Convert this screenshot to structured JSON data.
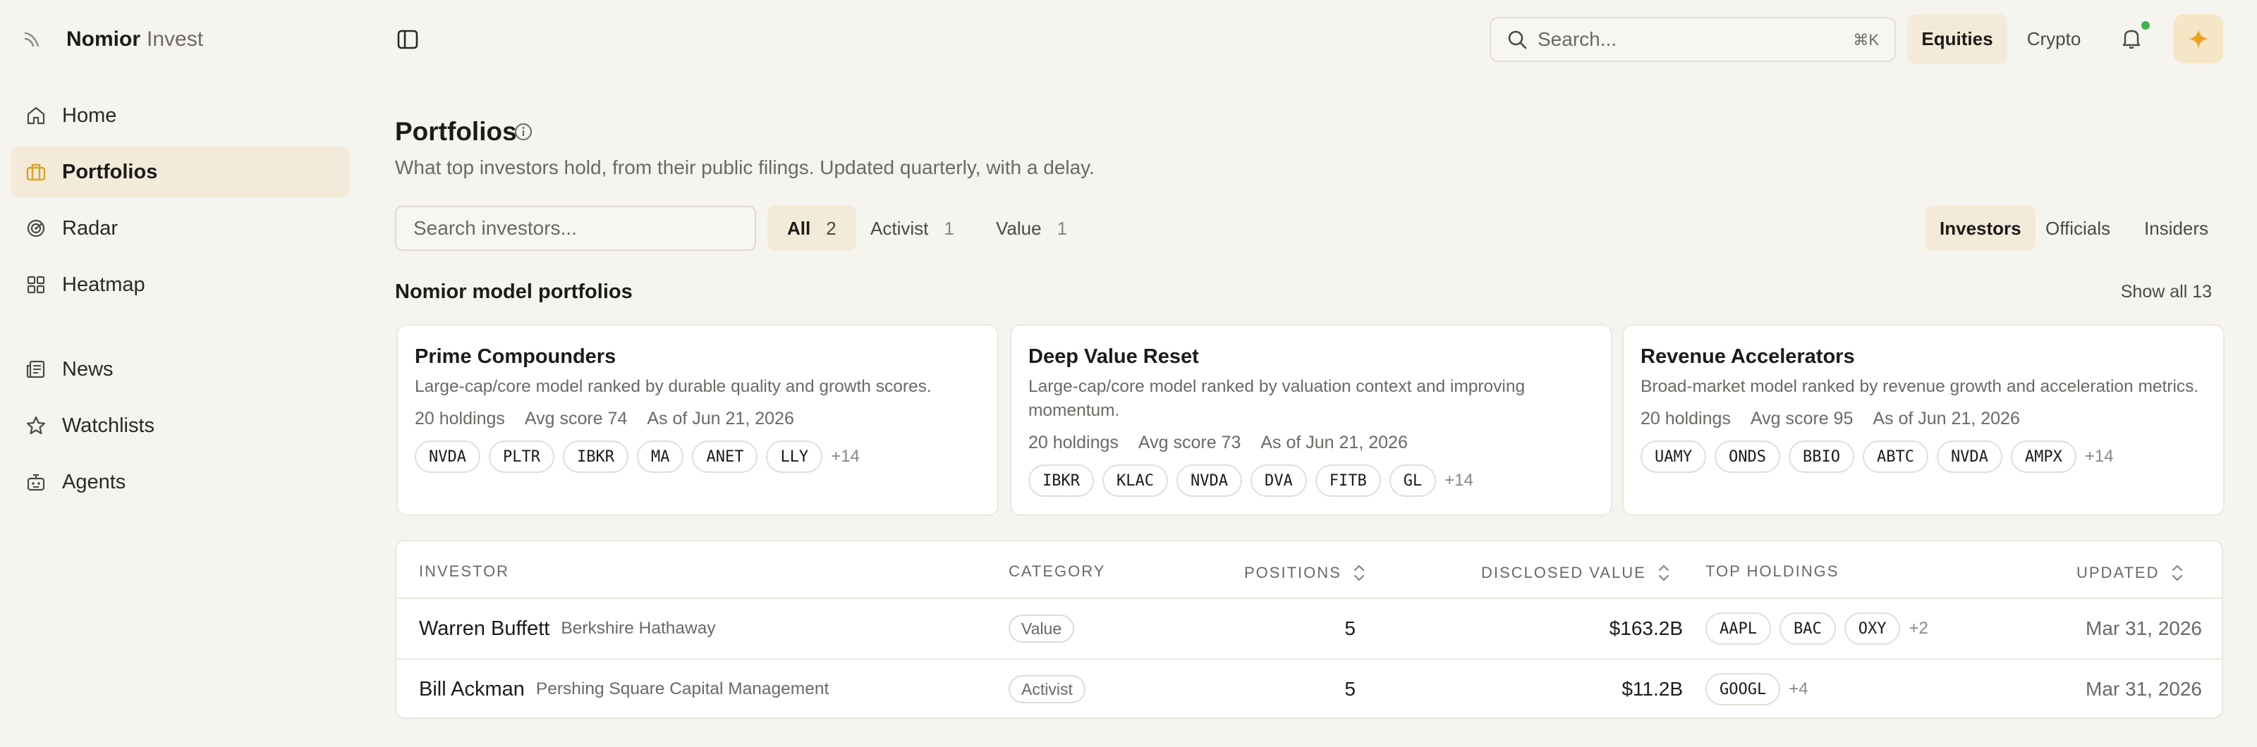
{
  "brand": {
    "name": "Nomior",
    "sub": "Invest"
  },
  "sidebar": {
    "items": [
      {
        "label": "Home",
        "icon": "home-icon"
      },
      {
        "label": "Portfolios",
        "icon": "briefcase-icon",
        "active": true
      },
      {
        "label": "Radar",
        "icon": "radar-icon"
      },
      {
        "label": "Heatmap",
        "icon": "grid-icon"
      },
      {
        "label": "News",
        "icon": "newspaper-icon"
      },
      {
        "label": "Watchlists",
        "icon": "star-icon"
      },
      {
        "label": "Agents",
        "icon": "bot-icon"
      }
    ]
  },
  "topbar": {
    "search_placeholder": "Search...",
    "search_shortcut": "⌘K",
    "segments": [
      "Equities",
      "Crypto"
    ],
    "accent_color": "#f0a020",
    "notification_dot_color": "#3bb54a"
  },
  "page": {
    "title": "Portfolios",
    "subtitle": "What top investors hold, from their public filings. Updated quarterly, with a delay."
  },
  "filters": {
    "search_placeholder": "Search investors...",
    "chips": [
      {
        "label": "All",
        "count": "2"
      },
      {
        "label": "Activist",
        "count": "1"
      },
      {
        "label": "Value",
        "count": "1"
      }
    ],
    "tabs": [
      "Investors",
      "Officials",
      "Insiders"
    ]
  },
  "models": {
    "title": "Nomior model portfolios",
    "show_all": "Show all 13",
    "cards": [
      {
        "title": "Prime Compounders",
        "desc": "Large-cap/core model ranked by durable quality and growth scores.",
        "holdings": "20 holdings",
        "score": "Avg score 74",
        "asof": "As of Jun 21, 2026",
        "tickers": [
          "NVDA",
          "PLTR",
          "IBKR",
          "MA",
          "ANET",
          "LLY"
        ],
        "more": "+14"
      },
      {
        "title": "Deep Value Reset",
        "desc": "Large-cap/core model ranked by valuation context and improving momentum.",
        "holdings": "20 holdings",
        "score": "Avg score 73",
        "asof": "As of Jun 21, 2026",
        "tickers": [
          "IBKR",
          "KLAC",
          "NVDA",
          "DVA",
          "FITB",
          "GL"
        ],
        "more": "+14"
      },
      {
        "title": "Revenue Accelerators",
        "desc": "Broad-market model ranked by revenue growth and acceleration metrics.",
        "holdings": "20 holdings",
        "score": "Avg score 95",
        "asof": "As of Jun 21, 2026",
        "tickers": [
          "UAMY",
          "ONDS",
          "BBIO",
          "ABTC",
          "NVDA",
          "AMPX"
        ],
        "more": "+14"
      }
    ]
  },
  "table": {
    "headers": [
      "INVESTOR",
      "CATEGORY",
      "POSITIONS",
      "DISCLOSED VALUE",
      "TOP HOLDINGS",
      "UPDATED"
    ],
    "rows": [
      {
        "name": "Warren Buffett",
        "firm": "Berkshire Hathaway",
        "category": "Value",
        "positions": "5",
        "value": "$163.2B",
        "holdings": [
          "AAPL",
          "BAC",
          "OXY"
        ],
        "more": "+2",
        "updated": "Mar 31, 2026"
      },
      {
        "name": "Bill Ackman",
        "firm": "Pershing Square Capital Management",
        "category": "Activist",
        "positions": "5",
        "value": "$11.2B",
        "holdings": [
          "GOOGL"
        ],
        "more": "+4",
        "updated": "Mar 31, 2026"
      }
    ]
  }
}
